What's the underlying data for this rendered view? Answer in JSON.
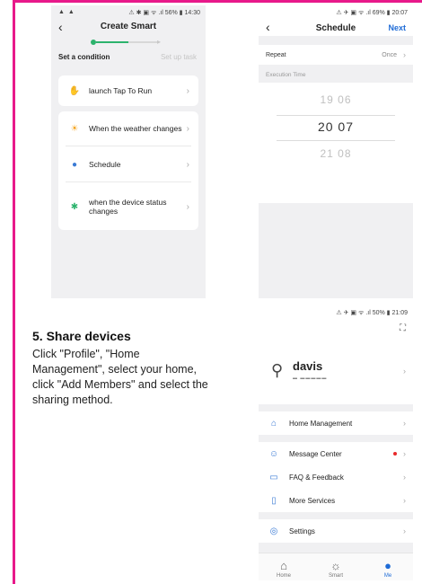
{
  "phone1": {
    "status_left": "▲ ▲",
    "status_right": "⚠ ✱ ▣ ᯤ .ıl 56% ▮ 14:30",
    "title": "Create Smart",
    "steps": [
      "Set a condition",
      "Set up task"
    ],
    "launch_item": "launch Tap To Run",
    "conditions": [
      {
        "label": "When the weather changes",
        "icon": "sun-icon",
        "color": "#f5a623"
      },
      {
        "label": "Schedule",
        "icon": "clock-icon",
        "color": "#3b7bd5"
      },
      {
        "label": "when the device status changes",
        "icon": "device-icon",
        "color": "#2db36d"
      }
    ]
  },
  "phone2": {
    "status_right": "⚠ ✈ ▣ ᯤ .ıl 69% ▮ 20:07",
    "title": "Schedule",
    "next_label": "Next",
    "repeat_label": "Repeat",
    "repeat_value": "Once",
    "section_label": "Execution Time",
    "times": [
      "19  06",
      "20  07",
      "21  08"
    ]
  },
  "phone3": {
    "status_right": "⚠ ✈ ▣ ᯤ .ıl 50% ▮ 21:09",
    "username": "davis",
    "subtext": "▬ ▬▬▬▬▬",
    "menu": [
      {
        "label": "Home Management",
        "icon": "home-icon"
      },
      {
        "label": "Message Center",
        "icon": "message-icon"
      },
      {
        "label": "FAQ & Feedback",
        "icon": "feedback-icon"
      },
      {
        "label": "More Services",
        "icon": "services-icon"
      },
      {
        "label": "Settings",
        "icon": "settings-icon"
      }
    ],
    "tabs": [
      "Home",
      "Smart",
      "Me"
    ]
  },
  "share": {
    "title": "5. Share devices",
    "body": "Click \"Profile\", \"Home Management\", select your home, click \"Add Members\" and select the sharing method."
  },
  "colors": {
    "accent": "#e8198a",
    "brand_blue": "#1e6bd6",
    "green": "#2db36d"
  }
}
